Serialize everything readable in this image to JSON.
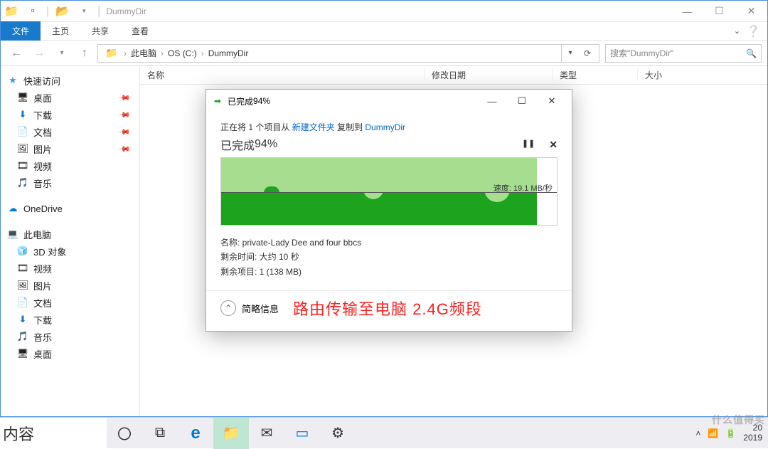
{
  "window": {
    "title": "DummyDir",
    "wctrl": {
      "min": "—",
      "max": "☐",
      "close": "✕"
    }
  },
  "ribbon": {
    "file": "文件",
    "tabs": [
      "主页",
      "共享",
      "查看"
    ]
  },
  "nav": {
    "back": "←",
    "fwd": "→",
    "up": "↑",
    "refresh": "⟳",
    "drop": "▾"
  },
  "breadcrumb": [
    "此电脑",
    "OS (C:)",
    "DummyDir"
  ],
  "search": {
    "placeholder": "搜索\"DummyDir\"",
    "icon": "🔍"
  },
  "columns": {
    "name": "名称",
    "date": "修改日期",
    "type": "类型",
    "size": "大小"
  },
  "sidebar": {
    "quick": {
      "label": "快速访问",
      "items": [
        {
          "icon": "🖥",
          "label": "桌面",
          "pin": true
        },
        {
          "icon": "⬇",
          "label": "下载",
          "pin": true
        },
        {
          "icon": "📄",
          "label": "文档",
          "pin": true
        },
        {
          "icon": "🖼",
          "label": "图片",
          "pin": true
        },
        {
          "icon": "🎞",
          "label": "视频",
          "pin": false
        },
        {
          "icon": "🎵",
          "label": "音乐",
          "pin": false
        }
      ]
    },
    "onedrive": {
      "icon": "☁",
      "label": "OneDrive"
    },
    "thispc": {
      "label": "此电脑",
      "items": [
        {
          "icon": "🧊",
          "label": "3D 对象"
        },
        {
          "icon": "🎞",
          "label": "视频"
        },
        {
          "icon": "🖼",
          "label": "图片"
        },
        {
          "icon": "📄",
          "label": "文档"
        },
        {
          "icon": "⬇",
          "label": "下载"
        },
        {
          "icon": "🎵",
          "label": "音乐"
        },
        {
          "icon": "🖥",
          "label": "桌面"
        }
      ]
    }
  },
  "copy": {
    "title_prefix": "已完成 ",
    "percent": "94%",
    "line_pre": "正在将 1 个项目从 ",
    "src": "新建文件夹",
    "line_mid": " 复制到 ",
    "dst": "DummyDir",
    "progress_pre": "已完成 ",
    "pause": "❚❚",
    "stop": "✕",
    "speed_label": "速度: ",
    "speed_val": "19.1 MB/秒",
    "meta_name_k": "名称: ",
    "meta_name_v": "private-Lady Dee and four bbcs",
    "meta_time_k": "剩余时间: ",
    "meta_time_v": "大约 10 秒",
    "meta_items_k": "剩余项目: ",
    "meta_items_v": "1 (138 MB)",
    "collapse": "简略信息",
    "wctrl": {
      "min": "—",
      "max": "☐",
      "close": "✕"
    }
  },
  "annotation": "路由传输至电脑 2.4G频段",
  "taskbar": {
    "cut": "内容",
    "cortana": "〇",
    "tasks": "⧉",
    "edge": "e",
    "folder": "📁",
    "mail": "✉",
    "wb": "▭",
    "gear": "⚙",
    "clock1": "20",
    "clock2": "2019"
  },
  "watermark": "什么值得买"
}
